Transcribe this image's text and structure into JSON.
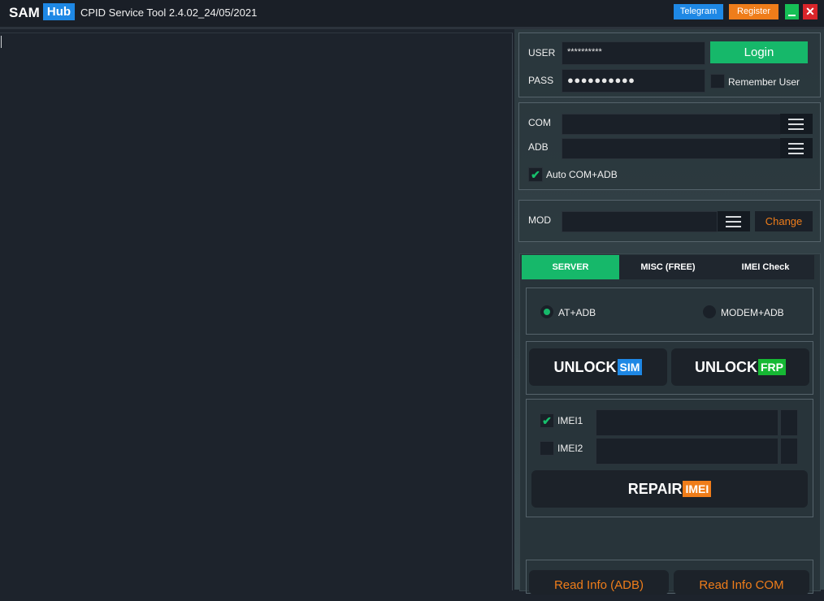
{
  "titlebar": {
    "logo_left": "SAM",
    "logo_right": "Hub",
    "title": "CPID Service Tool 2.4.02_24/05/2021",
    "telegram": "Telegram",
    "register": "Register",
    "close_glyph": "✕"
  },
  "login": {
    "user_label": "USER",
    "user_value": "**********",
    "pass_label": "PASS",
    "pass_value": "●●●●●●●●●●",
    "login_button": "Login",
    "remember_label": "Remember User",
    "remember_checked": false
  },
  "ports": {
    "com_label": "COM",
    "adb_label": "ADB",
    "auto_label": "Auto COM+ADB",
    "auto_checked": true,
    "check_glyph": "✔"
  },
  "mod": {
    "label": "MOD",
    "change_button": "Change"
  },
  "tabs": [
    {
      "label": "SERVER",
      "active": true
    },
    {
      "label": "MISC (FREE)",
      "active": false
    },
    {
      "label": "IMEI Check",
      "active": false
    }
  ],
  "server": {
    "mode_options": [
      {
        "label": "AT+ADB",
        "selected": true
      },
      {
        "label": "MODEM+ADB",
        "selected": false
      }
    ],
    "unlock_sim": {
      "word": "UNLOCK",
      "tag": "SIM"
    },
    "unlock_frp": {
      "word": "UNLOCK",
      "tag": "FRP"
    },
    "imei1_label": "IMEI1",
    "imei1_checked": true,
    "imei2_label": "IMEI2",
    "imei2_checked": false,
    "repair": {
      "word": "REPAIR",
      "tag": "IMEI"
    },
    "read_info_adb": "Read Info (ADB)",
    "read_info_com": "Read Info COM"
  },
  "colors": {
    "accent_green": "#16b86a",
    "accent_blue": "#1e88e5",
    "accent_orange": "#ef7d1a",
    "close_red": "#d9252a"
  }
}
